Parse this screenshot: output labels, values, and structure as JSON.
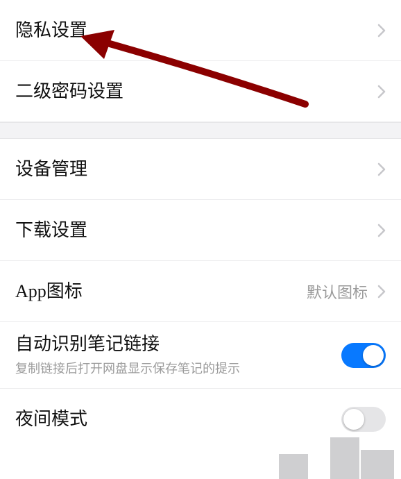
{
  "group1": [
    {
      "id": "privacy",
      "label": "隐私设置",
      "kind": "nav"
    },
    {
      "id": "secondary-pwd",
      "label": "二级密码设置",
      "kind": "nav"
    }
  ],
  "group2": [
    {
      "id": "devices",
      "label": "设备管理",
      "kind": "nav"
    },
    {
      "id": "download",
      "label": "下载设置",
      "kind": "nav"
    },
    {
      "id": "app-icon",
      "label": "App图标",
      "kind": "nav",
      "value": "默认图标"
    },
    {
      "id": "auto-link",
      "label": "自动识别笔记链接",
      "sub": "复制链接后打开网盘显示保存笔记的提示",
      "kind": "toggle",
      "on": true
    },
    {
      "id": "night",
      "label": "夜间模式",
      "kind": "toggle",
      "on": false
    }
  ]
}
